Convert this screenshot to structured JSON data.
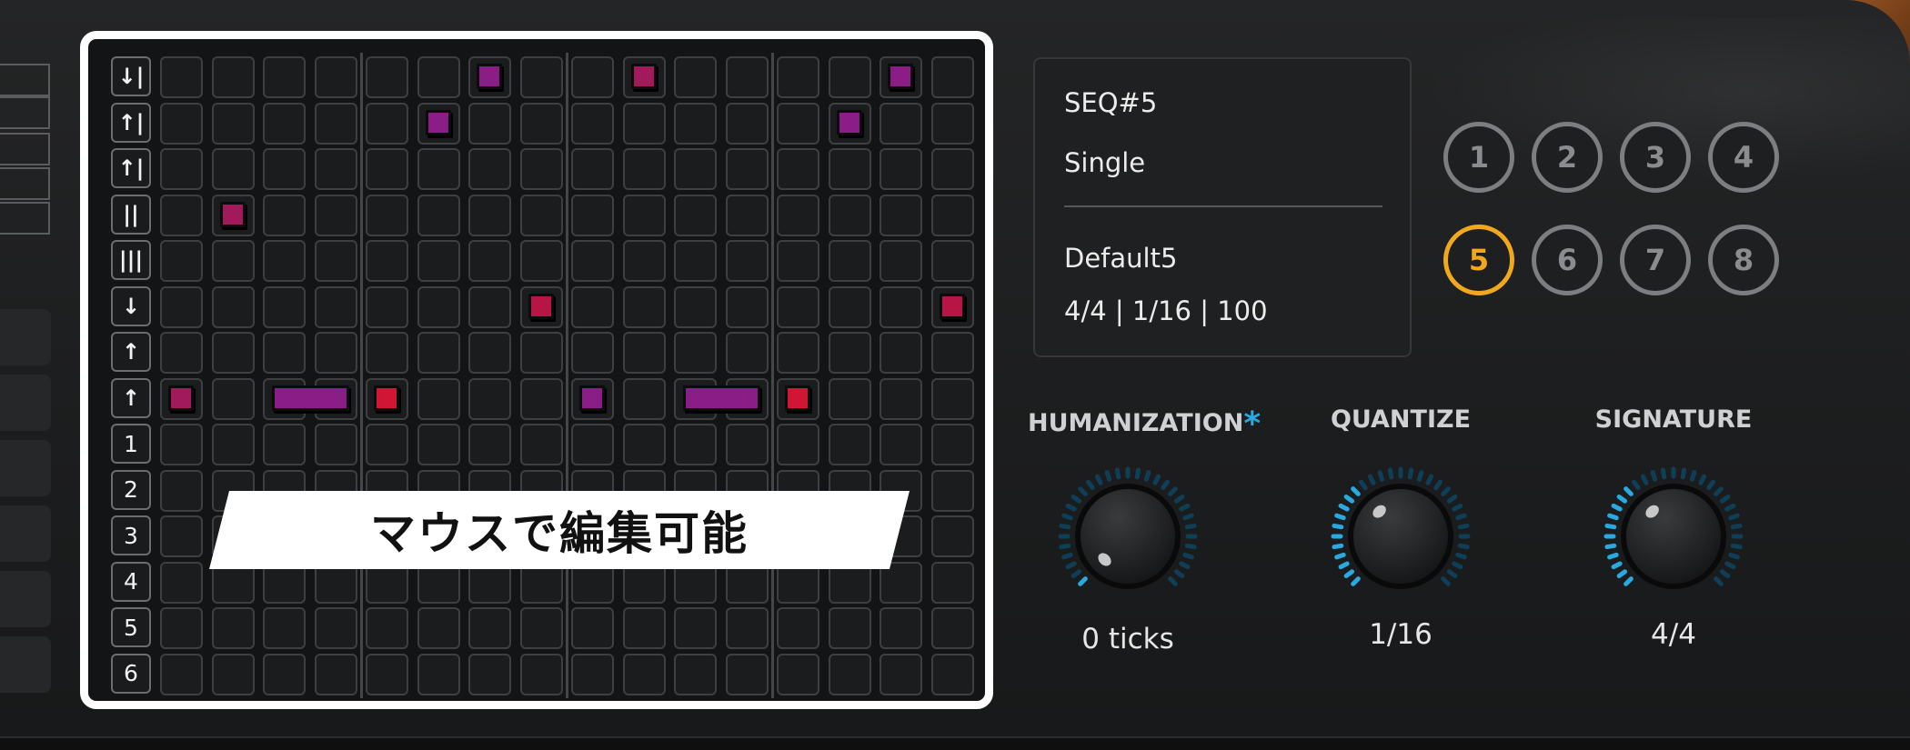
{
  "sequencer": {
    "lane_labels": [
      "↓|",
      "↑|",
      "↑|",
      "||",
      "|||",
      "↓",
      "↑",
      "↑",
      "1",
      "2",
      "3",
      "4",
      "5",
      "6"
    ],
    "steps": 16,
    "notes": [
      {
        "lane": 0,
        "step": 6,
        "length": 1,
        "color": "#8a1e86"
      },
      {
        "lane": 0,
        "step": 9,
        "length": 1,
        "color": "#a01a5c"
      },
      {
        "lane": 0,
        "step": 14,
        "length": 1,
        "color": "#8a1e86"
      },
      {
        "lane": 1,
        "step": 5,
        "length": 1,
        "color": "#8a1e86"
      },
      {
        "lane": 1,
        "step": 13,
        "length": 1,
        "color": "#8a1e86"
      },
      {
        "lane": 3,
        "step": 1,
        "length": 1,
        "color": "#a01a5c"
      },
      {
        "lane": 5,
        "step": 7,
        "length": 1,
        "color": "#b81547"
      },
      {
        "lane": 5,
        "step": 15,
        "length": 1,
        "color": "#b81547"
      },
      {
        "lane": 7,
        "step": 0,
        "length": 1,
        "color": "#a01a5c"
      },
      {
        "lane": 7,
        "step": 2,
        "length": 2,
        "color": "#8a1e86"
      },
      {
        "lane": 7,
        "step": 4,
        "length": 1,
        "color": "#d01535"
      },
      {
        "lane": 7,
        "step": 8,
        "length": 1,
        "color": "#8a1e86"
      },
      {
        "lane": 7,
        "step": 10,
        "length": 2,
        "color": "#8a1e86"
      },
      {
        "lane": 7,
        "step": 12,
        "length": 1,
        "color": "#d01535"
      }
    ],
    "banner_text": "マウスで編集可能"
  },
  "info": {
    "seq_name": "SEQ#5",
    "mode": "Single",
    "preset": "Default5",
    "meta": "4/4 | 1/16 | 100"
  },
  "seq_buttons": {
    "labels": [
      "1",
      "2",
      "3",
      "4",
      "5",
      "6",
      "7",
      "8"
    ],
    "active": "5"
  },
  "knobs": {
    "humanization": {
      "title": "HUMANIZATION",
      "asterisk": "*",
      "value": "0 ticks",
      "level": 0.0
    },
    "quantize": {
      "title": "QUANTIZE",
      "value": "1/16",
      "level": 0.35
    },
    "signature": {
      "title": "SIGNATURE",
      "value": "4/4",
      "level": 0.35
    }
  },
  "colors": {
    "accent_active": "#f2a81d",
    "knob_ring": "#29a9e0",
    "highlight_frame": "#ffffff"
  }
}
